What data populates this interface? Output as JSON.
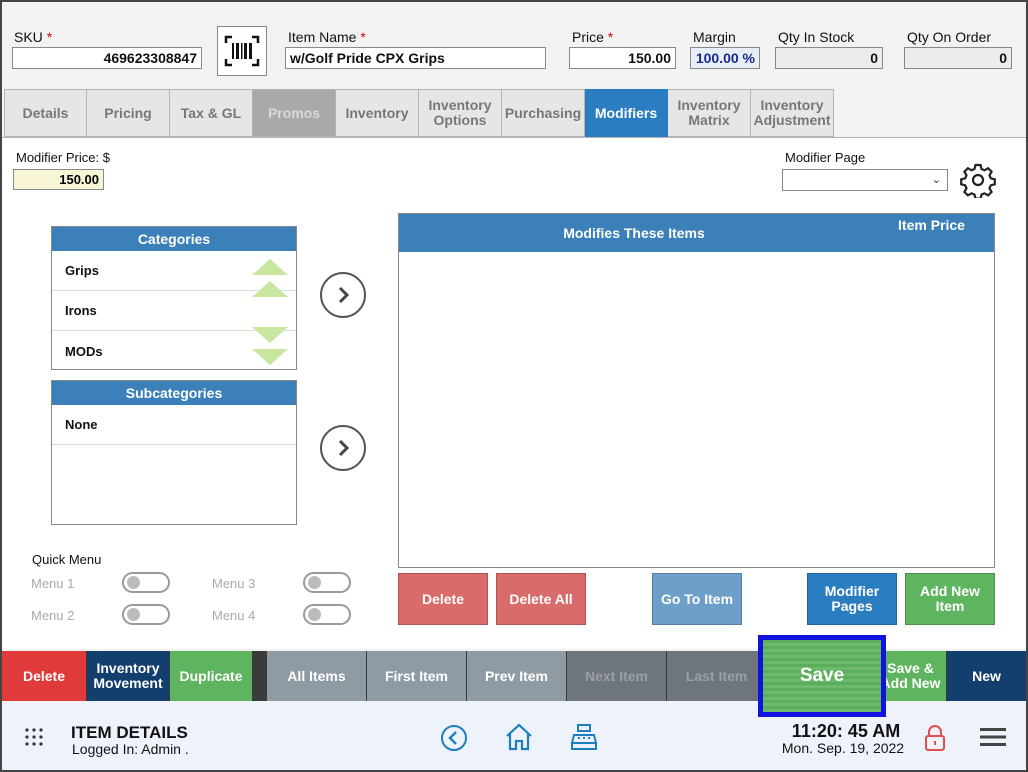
{
  "header": {
    "sku_label": "SKU",
    "sku_value": "469623308847",
    "item_name_label": "Item Name",
    "item_name_value": "w/Golf Pride CPX Grips",
    "price_label": "Price",
    "price_value": "150.00",
    "margin_label": "Margin",
    "margin_value": "100.00 %",
    "qty_in_stock_label": "Qty In Stock",
    "qty_in_stock_value": "0",
    "qty_on_order_label": "Qty On Order",
    "qty_on_order_value": "0",
    "required_mark": "*"
  },
  "tabs": [
    {
      "label": "Details"
    },
    {
      "label": "Pricing"
    },
    {
      "label": "Tax & GL"
    },
    {
      "label": "Promos"
    },
    {
      "label": "Inventory"
    },
    {
      "label": "Inventory Options"
    },
    {
      "label": "Purchasing"
    },
    {
      "label": "Modifiers"
    },
    {
      "label": "Inventory Matrix"
    },
    {
      "label": "Inventory Adjustment"
    }
  ],
  "modifiers": {
    "modifier_price_label": "Modifier Price: $",
    "modifier_price_value": "150.00",
    "modifier_page_label": "Modifier Page",
    "modifier_page_value": "",
    "categories_title": "Categories",
    "categories": [
      "Grips",
      "Irons",
      "MODs"
    ],
    "subcategories_title": "Subcategories",
    "subcategories": [
      "None"
    ],
    "grid_col1": "Modifies These Items",
    "grid_col2": "Item Price",
    "delete_label": "Delete",
    "delete_all_label": "Delete All",
    "go_to_item_label": "Go To Item",
    "modifier_pages_label": "Modifier Pages",
    "add_new_item_label": "Add New Item"
  },
  "quick_menu": {
    "title": "Quick Menu",
    "items": [
      "Menu 1",
      "Menu 2",
      "Menu 3",
      "Menu 4"
    ]
  },
  "action_bar": {
    "delete": "Delete",
    "inventory_movement": "Inventory Movement",
    "duplicate": "Duplicate",
    "all_items": "All Items",
    "first_item": "First Item",
    "prev_item": "Prev Item",
    "next_item": "Next Item",
    "last_item": "Last Item",
    "save": "Save",
    "save_add_new": "Save & Add New",
    "new": "New"
  },
  "footer": {
    "title": "ITEM DETAILS",
    "logged_in": "Logged In:  Admin .",
    "time": "11:20: 45 AM",
    "date": "Mon. Sep. 19, 2022"
  },
  "colors": {
    "accent": "#2a7dc1",
    "panel_header": "#3c80b9",
    "red": "#e03a3a",
    "green": "#5fb55f",
    "navy": "#133f6e",
    "highlight_border": "#1212e0"
  }
}
